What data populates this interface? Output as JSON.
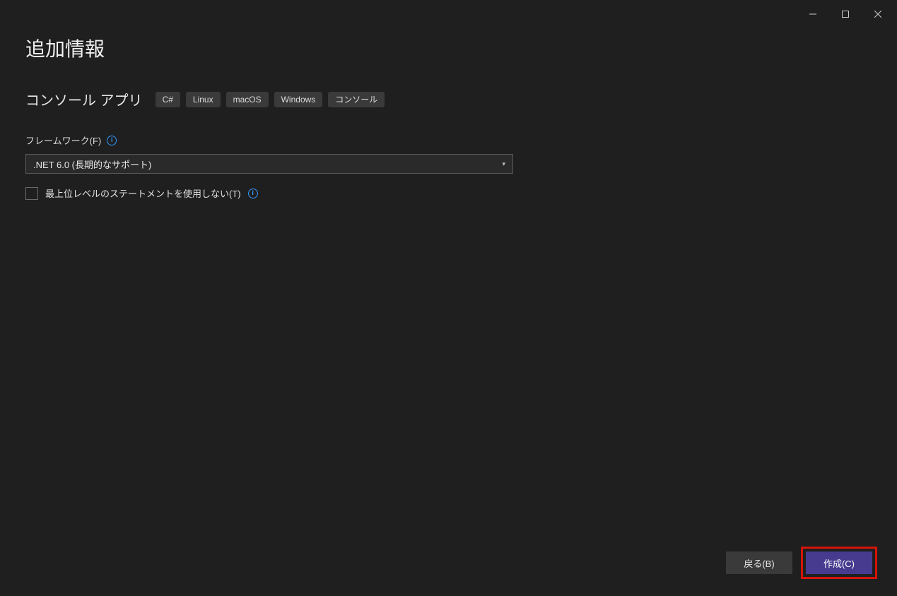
{
  "heading": "追加情報",
  "subheader": {
    "title": "コンソール アプリ",
    "tags": [
      "C#",
      "Linux",
      "macOS",
      "Windows",
      "コンソール"
    ]
  },
  "framework": {
    "label": "フレームワーク(F)",
    "selected": ".NET 6.0 (長期的なサポート)"
  },
  "checkbox": {
    "label": "最上位レベルのステートメントを使用しない(T)"
  },
  "infoIcon": "i",
  "footer": {
    "back": "戻る(B)",
    "create": "作成(C)"
  }
}
